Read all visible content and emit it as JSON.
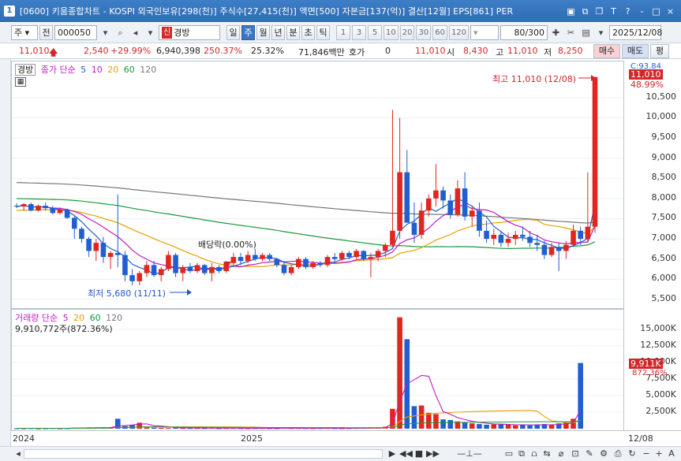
{
  "window": {
    "badge": "1",
    "title": "[0600] 키움종합차트 - KOSPI 외국인보유[298(천)] 주식수[27,415(천)] 액면[500] 자본금[137(억)] 결산[12월] EPS[861] PER",
    "controls": [
      "▣",
      "⧉",
      "❐",
      "T",
      "?",
      "-",
      "□",
      "×"
    ]
  },
  "toolbar": {
    "period_type": "주",
    "prev_label": "전",
    "code": "000050",
    "new_badge": "신",
    "name": "경방",
    "timeframes": [
      "일",
      "주",
      "월",
      "년",
      "분",
      "초",
      "틱"
    ],
    "active_timeframe": "주",
    "intervals": [
      "1",
      "3",
      "5",
      "10",
      "20",
      "30",
      "60",
      "120"
    ],
    "count": "80",
    "count_total": "/300",
    "date": "2025/12/08"
  },
  "quote": {
    "price": "11,010",
    "change": "2,540",
    "change_pct": "+29.99%",
    "volume": "6,940,398",
    "volume_ratio": "250.37%",
    "turnover_pct": "25.32%",
    "amount": "71,846백만",
    "hoga_label": "호가",
    "hoga_value": "0",
    "bid": "11,010",
    "open_label": "시",
    "open": "8,430",
    "high_label": "고",
    "high": "11,010",
    "low_label": "저",
    "low": "8,250",
    "buy_label": "매수",
    "sell_label": "매도",
    "avg_label": "평"
  },
  "price_pane": {
    "name_tag": "경방",
    "legend": {
      "prefix": "종가 단순",
      "periods": [
        "5",
        "10",
        "20",
        "60",
        "120"
      ],
      "colors": [
        "#1f5fd0",
        "#c01cc0",
        "#e8a000",
        "#1a9a3a",
        "#777777"
      ]
    },
    "dividend_note": "배당락(0.00%)",
    "low_note": "최저 5,680 (11/11)",
    "high_note": "최고 11,010 (12/08)",
    "right_tags": {
      "c": "C:93.84",
      "last": "11,010",
      "pct": "48.99%"
    }
  },
  "volume_pane": {
    "legend": {
      "prefix": "거래량 단순",
      "periods": [
        "5",
        "20",
        "60",
        "120"
      ],
      "colors": [
        "#c01cc0",
        "#e8a000",
        "#1a9a3a",
        "#777777"
      ]
    },
    "value_note": "9,910,772주(872.36%)",
    "right_tags": {
      "last": "9,911K",
      "pct": "872.36%"
    }
  },
  "x_axis": {
    "labels": [
      "2024",
      "2025"
    ],
    "end_label": "12/08"
  },
  "chart_data": [
    {
      "type": "candlestick",
      "title": "",
      "ylim": [
        5400,
        11200
      ],
      "yticks": [
        5500,
        6000,
        6500,
        7000,
        7500,
        8000,
        8500,
        9000,
        9500,
        10000,
        10500
      ],
      "ytick_labels": [
        "5,500",
        "6,000",
        "6,500",
        "7,000",
        "7,500",
        "8,000",
        "8,500",
        "9,000",
        "9,500",
        "10,000",
        "10,500"
      ],
      "candles": [
        [
          7820,
          7880,
          7760,
          7800
        ],
        [
          7800,
          7880,
          7700,
          7860
        ],
        [
          7860,
          7900,
          7680,
          7700
        ],
        [
          7700,
          7850,
          7680,
          7820
        ],
        [
          7820,
          7900,
          7700,
          7760
        ],
        [
          7760,
          7820,
          7600,
          7640
        ],
        [
          7640,
          7780,
          7600,
          7720
        ],
        [
          7720,
          7750,
          7500,
          7520
        ],
        [
          7520,
          7560,
          7000,
          7250
        ],
        [
          7250,
          7300,
          6900,
          7000
        ],
        [
          7000,
          7050,
          6550,
          6700
        ],
        [
          6700,
          7000,
          6450,
          6900
        ],
        [
          6900,
          7050,
          6400,
          6550
        ],
        [
          6550,
          6700,
          6250,
          6650
        ],
        [
          6650,
          8100,
          6300,
          6600
        ],
        [
          6600,
          6700,
          5950,
          6100
        ],
        [
          6100,
          6250,
          5850,
          5950
        ],
        [
          5950,
          6200,
          5850,
          6150
        ],
        [
          6150,
          6450,
          6050,
          6350
        ],
        [
          6350,
          6450,
          6050,
          6100
        ],
        [
          6100,
          6300,
          5950,
          6250
        ],
        [
          6250,
          6700,
          6200,
          6600
        ],
        [
          6600,
          6650,
          6050,
          6150
        ],
        [
          6150,
          6350,
          5950,
          6300
        ],
        [
          6300,
          6400,
          6150,
          6200
        ],
        [
          6200,
          6400,
          6150,
          6350
        ],
        [
          6350,
          6380,
          6100,
          6150
        ],
        [
          6150,
          6400,
          5950,
          6300
        ],
        [
          6300,
          6350,
          6150,
          6200
        ],
        [
          6200,
          6450,
          6150,
          6400
        ],
        [
          6400,
          6650,
          6350,
          6550
        ],
        [
          6550,
          6650,
          6350,
          6450
        ],
        [
          6450,
          6700,
          6400,
          6600
        ],
        [
          6600,
          6750,
          6450,
          6500
        ],
        [
          6500,
          6650,
          6450,
          6600
        ],
        [
          6600,
          6650,
          6450,
          6500
        ],
        [
          6500,
          6520,
          6300,
          6350
        ],
        [
          6350,
          6450,
          6100,
          6150
        ],
        [
          6150,
          6350,
          6100,
          6300
        ],
        [
          6300,
          6550,
          6250,
          6500
        ],
        [
          6500,
          6550,
          6250,
          6300
        ],
        [
          6300,
          6450,
          6250,
          6400
        ],
        [
          6400,
          6450,
          6300,
          6350
        ],
        [
          6350,
          6600,
          6300,
          6550
        ],
        [
          6550,
          6650,
          6400,
          6500
        ],
        [
          6500,
          6700,
          6450,
          6650
        ],
        [
          6650,
          6700,
          6500,
          6550
        ],
        [
          6550,
          6750,
          6500,
          6700
        ],
        [
          6700,
          6720,
          6450,
          6500
        ],
        [
          6500,
          6650,
          6050,
          6550
        ],
        [
          6550,
          6750,
          6450,
          6700
        ],
        [
          6700,
          6900,
          6550,
          6850
        ],
        [
          6850,
          10200,
          6800,
          7200
        ],
        [
          7200,
          10000,
          7000,
          8650
        ],
        [
          8650,
          9200,
          7400,
          7400
        ],
        [
          7400,
          7900,
          6900,
          7100
        ],
        [
          7100,
          7900,
          7000,
          7700
        ],
        [
          7700,
          8100,
          7550,
          8000
        ],
        [
          8000,
          8850,
          7800,
          8200
        ],
        [
          8200,
          8300,
          7750,
          7950
        ],
        [
          7950,
          8100,
          7500,
          7600
        ],
        [
          7600,
          8450,
          7550,
          8250
        ],
        [
          8250,
          8650,
          7450,
          7550
        ],
        [
          7550,
          7800,
          7300,
          7700
        ],
        [
          7700,
          7900,
          7050,
          7200
        ],
        [
          7200,
          7450,
          6900,
          7000
        ],
        [
          7000,
          7250,
          6850,
          7100
        ],
        [
          7100,
          7200,
          6800,
          6900
        ],
        [
          6900,
          7150,
          6800,
          7000
        ],
        [
          7000,
          7200,
          6850,
          7100
        ],
        [
          7100,
          7300,
          6950,
          7050
        ],
        [
          7050,
          7200,
          6800,
          6900
        ],
        [
          6900,
          7100,
          6700,
          6850
        ],
        [
          6850,
          6950,
          6500,
          6600
        ],
        [
          6600,
          6900,
          6550,
          6800
        ],
        [
          6800,
          6900,
          6200,
          6700
        ],
        [
          6700,
          6950,
          6500,
          6850
        ],
        [
          6850,
          7350,
          6800,
          7200
        ],
        [
          7200,
          7300,
          6850,
          7000
        ],
        [
          7000,
          8650,
          6900,
          7300
        ],
        [
          7300,
          11010,
          7150,
          11010
        ]
      ]
    },
    {
      "type": "bar",
      "title": "",
      "ylim": [
        0,
        17000
      ],
      "yticks": [
        2500,
        5000,
        7500,
        10000,
        12500,
        15000
      ],
      "ytick_labels": [
        "2,500K",
        "5,000K",
        "7,500K",
        "10,000K",
        "12,500K",
        "15,000K"
      ],
      "volumes_k": [
        60,
        50,
        80,
        40,
        60,
        90,
        50,
        70,
        150,
        120,
        200,
        180,
        150,
        120,
        1500,
        400,
        600,
        900,
        200,
        150,
        120,
        100,
        180,
        90,
        80,
        90,
        70,
        120,
        60,
        80,
        90,
        70,
        60,
        80,
        90,
        70,
        60,
        120,
        80,
        90,
        70,
        60,
        80,
        90,
        70,
        60,
        80,
        100,
        120,
        200,
        180,
        300,
        3000,
        16800,
        13500,
        3400,
        3500,
        2400,
        2200,
        1400,
        1300,
        1100,
        900,
        800,
        700,
        600,
        650,
        700,
        600,
        500,
        550,
        500,
        650,
        700,
        600,
        800,
        900,
        1500,
        9910
      ],
      "series": [
        {
          "name": "5",
          "values_k": [
            7000,
            6000,
            2500,
            1800,
            1500,
            1400,
            1200
          ]
        },
        {
          "name": "20",
          "values_k": [
            2300,
            2200,
            2000,
            1500,
            1000
          ]
        }
      ]
    }
  ]
}
